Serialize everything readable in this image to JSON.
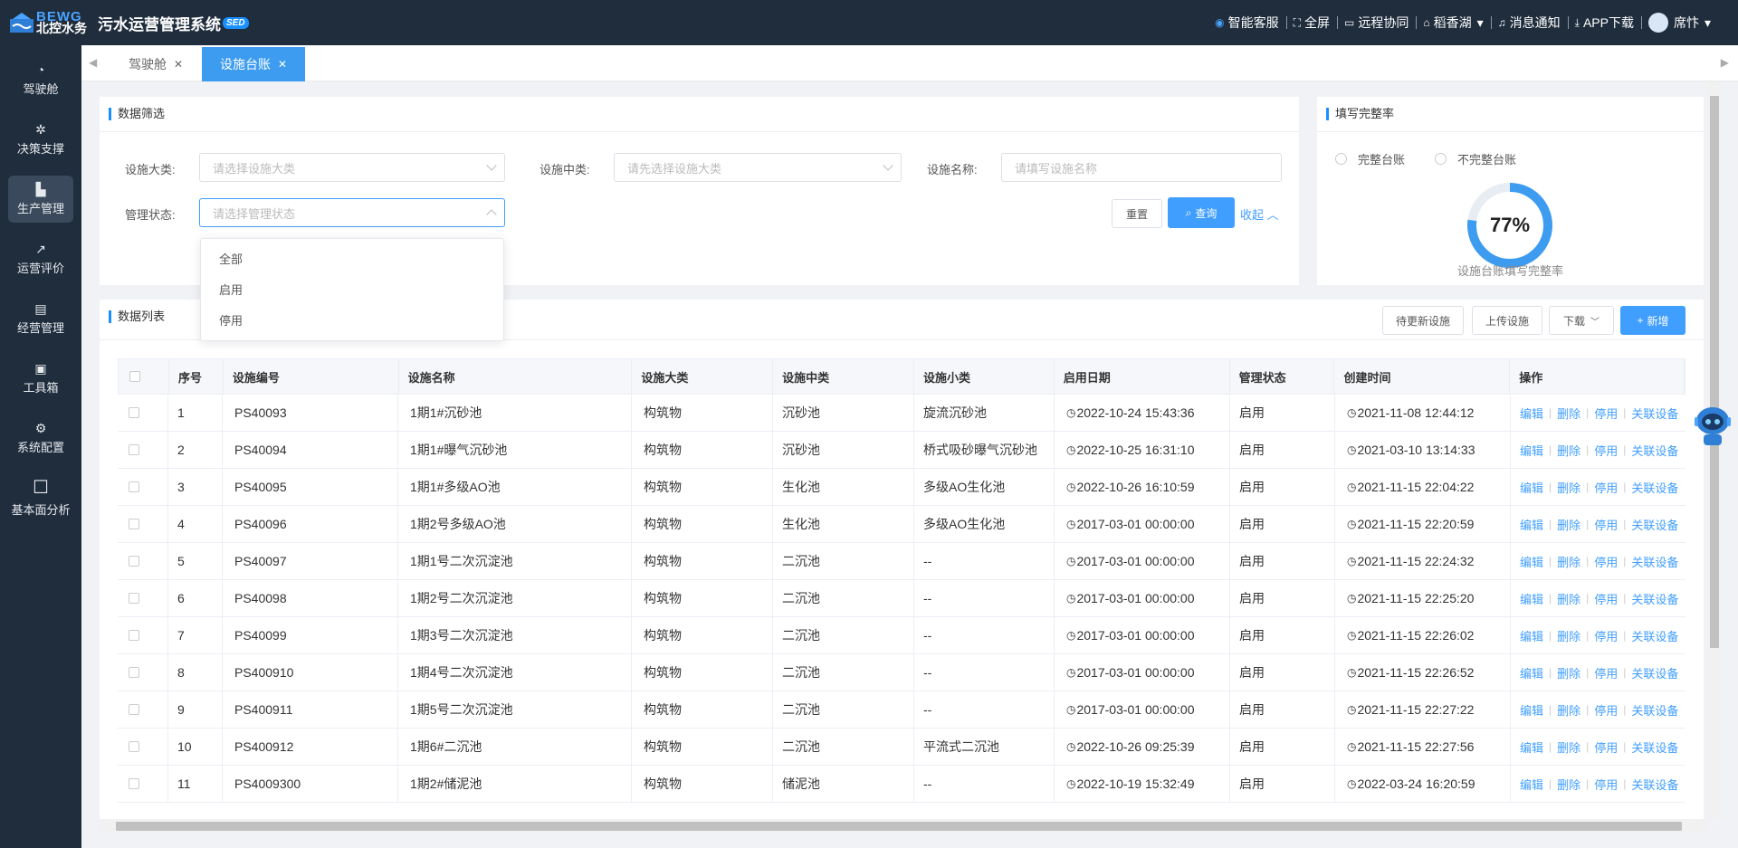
{
  "header": {
    "logo_en": "BEWG",
    "logo_cn": "北控水务",
    "title": "污水运营管理系统",
    "badge": "SED",
    "actions": [
      {
        "icon": "robot-chat-icon",
        "label": "智能客服"
      },
      {
        "icon": "fullscreen-icon",
        "label": "全屏"
      },
      {
        "icon": "remote-icon",
        "label": "远程协同"
      },
      {
        "icon": "home-icon",
        "label": "稻香湖"
      },
      {
        "icon": "bell-icon",
        "label": "消息通知"
      },
      {
        "icon": "download-icon",
        "label": "APP下载"
      },
      {
        "icon": "avatar-icon",
        "label": "席忭"
      }
    ]
  },
  "sidebar": {
    "items": [
      {
        "label": "驾驶舱",
        "icon": "dashboard-icon"
      },
      {
        "label": "决策支撑",
        "icon": "decision-icon"
      },
      {
        "label": "生产管理",
        "icon": "factory-icon",
        "active": true
      },
      {
        "label": "运营评价",
        "icon": "chart-icon"
      },
      {
        "label": "经营管理",
        "icon": "briefcase-icon"
      },
      {
        "label": "工具箱",
        "icon": "toolbox-icon"
      },
      {
        "label": "系统配置",
        "icon": "settings-icon"
      },
      {
        "label": "基本面分析",
        "icon": "square-icon"
      }
    ]
  },
  "tabs": [
    {
      "label": "驾驶舱",
      "active": false
    },
    {
      "label": "设施台账",
      "active": true
    }
  ],
  "filter": {
    "title": "数据筛选",
    "major_label": "设施大类:",
    "major_placeholder": "请选择设施大类",
    "mid_label": "设施中类:",
    "mid_placeholder": "请先选择设施大类",
    "name_label": "设施名称:",
    "name_placeholder": "请填写设施名称",
    "status_label": "管理状态:",
    "status_placeholder": "请选择管理状态",
    "status_options": [
      "全部",
      "启用",
      "停用"
    ],
    "reset": "重置",
    "query": "查询",
    "collapse": "收起"
  },
  "completeness": {
    "title": "填写完整率",
    "radio_complete": "完整台账",
    "radio_incomplete": "不完整台账",
    "value_text": "77%",
    "value": 0.77,
    "caption": "设施台账填写完整率",
    "color": "#3d9cf0"
  },
  "list": {
    "title": "数据列表",
    "btn_pending": "待更新设施",
    "btn_upload": "上传设施",
    "btn_download": "下载",
    "btn_add": "新增",
    "columns": [
      "序号",
      "设施编号",
      "设施名称",
      "设施大类",
      "设施中类",
      "设施小类",
      "启用日期",
      "管理状态",
      "创建时间",
      "操作"
    ],
    "ops": [
      "编辑",
      "删除",
      "停用",
      "关联设备"
    ],
    "rows": [
      [
        "1",
        "PS40093",
        "1期1#沉砂池",
        "构筑物",
        "沉砂池",
        "旋流沉砂池",
        "2022-10-24 15:43:36",
        "启用",
        "2021-11-08 12:44:12"
      ],
      [
        "2",
        "PS40094",
        "1期1#曝气沉砂池",
        "构筑物",
        "沉砂池",
        "桥式吸砂曝气沉砂池",
        "2022-10-25 16:31:10",
        "启用",
        "2021-03-10 13:14:33"
      ],
      [
        "3",
        "PS40095",
        "1期1#多级AO池",
        "构筑物",
        "生化池",
        "多级AO生化池",
        "2022-10-26 16:10:59",
        "启用",
        "2021-11-15 22:04:22"
      ],
      [
        "4",
        "PS40096",
        "1期2号多级AO池",
        "构筑物",
        "生化池",
        "多级AO生化池",
        "2017-03-01 00:00:00",
        "启用",
        "2021-11-15 22:20:59"
      ],
      [
        "5",
        "PS40097",
        "1期1号二次沉淀池",
        "构筑物",
        "二沉池",
        "--",
        "2017-03-01 00:00:00",
        "启用",
        "2021-11-15 22:24:32"
      ],
      [
        "6",
        "PS40098",
        "1期2号二次沉淀池",
        "构筑物",
        "二沉池",
        "--",
        "2017-03-01 00:00:00",
        "启用",
        "2021-11-15 22:25:20"
      ],
      [
        "7",
        "PS40099",
        "1期3号二次沉淀池",
        "构筑物",
        "二沉池",
        "--",
        "2017-03-01 00:00:00",
        "启用",
        "2021-11-15 22:26:02"
      ],
      [
        "8",
        "PS400910",
        "1期4号二次沉淀池",
        "构筑物",
        "二沉池",
        "--",
        "2017-03-01 00:00:00",
        "启用",
        "2021-11-15 22:26:52"
      ],
      [
        "9",
        "PS400911",
        "1期5号二次沉淀池",
        "构筑物",
        "二沉池",
        "--",
        "2017-03-01 00:00:00",
        "启用",
        "2021-11-15 22:27:22"
      ],
      [
        "10",
        "PS400912",
        "1期6#二沉池",
        "构筑物",
        "二沉池",
        "平流式二沉池",
        "2022-10-26 09:25:39",
        "启用",
        "2021-11-15 22:27:56"
      ],
      [
        "11",
        "PS4009300",
        "1期2#储泥池",
        "构筑物",
        "储泥池",
        "--",
        "2022-10-19 15:32:49",
        "启用",
        "2022-03-24 16:20:59"
      ]
    ]
  }
}
